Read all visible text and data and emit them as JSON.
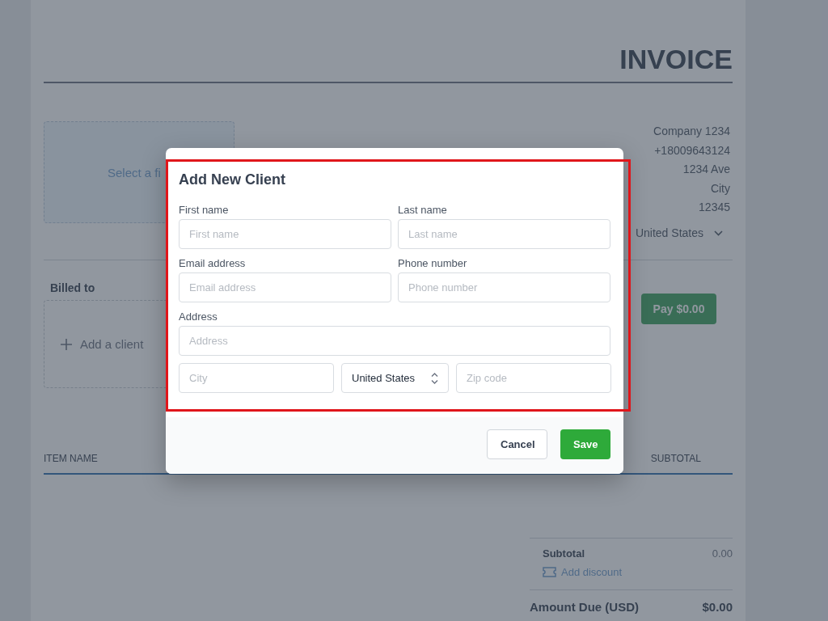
{
  "invoice": {
    "title": "INVOICE",
    "logo_placeholder": "Select a fi",
    "company_lines": [
      "Company 1234",
      "+18009643124",
      "1234 Ave",
      "City",
      "12345"
    ],
    "company_country": "United States",
    "billed_to_label": "Billed to",
    "add_client": "Add a client",
    "pay_button": "Pay $0.00",
    "table_columns": [
      "ITEM NAME",
      "SUBTOTAL"
    ],
    "subtotal_label": "Subtotal",
    "subtotal_value": "0.00",
    "add_discount": "Add discount",
    "amount_due_label": "Amount Due (USD)",
    "amount_due_value": "$0.00"
  },
  "dialog": {
    "title": "Add New Client",
    "highlighted": true,
    "fields": [
      {
        "label": "First name",
        "placeholder": "First name"
      },
      {
        "label": "Last name",
        "placeholder": "Last name"
      },
      {
        "label": "Email address",
        "placeholder": "Email address"
      },
      {
        "label": "Phone number",
        "placeholder": "Phone number"
      },
      {
        "label": "Address",
        "placeholder": "Address"
      }
    ],
    "address_row": [
      {
        "kind": "input",
        "placeholder": "City"
      },
      {
        "kind": "select",
        "value": "United States"
      },
      {
        "kind": "input",
        "placeholder": "Zip code"
      }
    ],
    "buttons": [
      {
        "label": "Cancel",
        "kind": "secondary"
      },
      {
        "label": "Save",
        "kind": "primary"
      }
    ]
  }
}
